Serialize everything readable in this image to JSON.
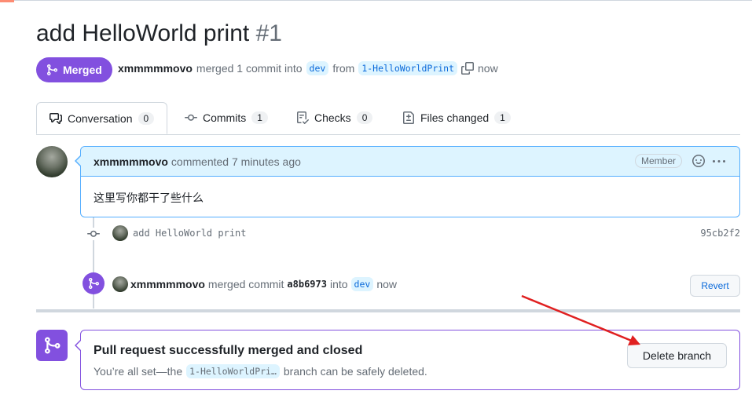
{
  "pr": {
    "title": "add HelloWorld print",
    "number": "#1",
    "state_label": "Merged",
    "author": "xmmmmmovo",
    "merge_text": "merged 1 commit into",
    "base_branch": "dev",
    "from_text": "from",
    "head_branch": "1-HelloWorldPrint",
    "time": "now"
  },
  "tabs": [
    {
      "label": "Conversation",
      "count": "0",
      "icon": "comment-discussion-icon"
    },
    {
      "label": "Commits",
      "count": "1",
      "icon": "git-commit-icon"
    },
    {
      "label": "Checks",
      "count": "0",
      "icon": "checklist-icon"
    },
    {
      "label": "Files changed",
      "count": "1",
      "icon": "file-diff-icon"
    }
  ],
  "comment": {
    "author": "xmmmmmovo",
    "action": "commented 7 minutes ago",
    "role_badge": "Member",
    "body": "这里写你都干了些什么"
  },
  "commit": {
    "message": "add HelloWorld print",
    "sha": "95cb2f2"
  },
  "merge_event": {
    "author": "xmmmmmovo",
    "text1": "merged commit",
    "sha": "a8b6973",
    "text2": "into",
    "branch": "dev",
    "time": "now",
    "revert_label": "Revert"
  },
  "merge_box": {
    "title": "Pull request successfully merged and closed",
    "desc_prefix": "You’re all set—the",
    "branch": "1-HelloWorldPri…",
    "desc_suffix": "branch can be safely deleted.",
    "delete_label": "Delete branch"
  },
  "colors": {
    "merged_purple": "#8250df",
    "link_blue": "#0969da",
    "comment_header_bg": "#ddf4ff",
    "annotation_red": "#e02020"
  }
}
